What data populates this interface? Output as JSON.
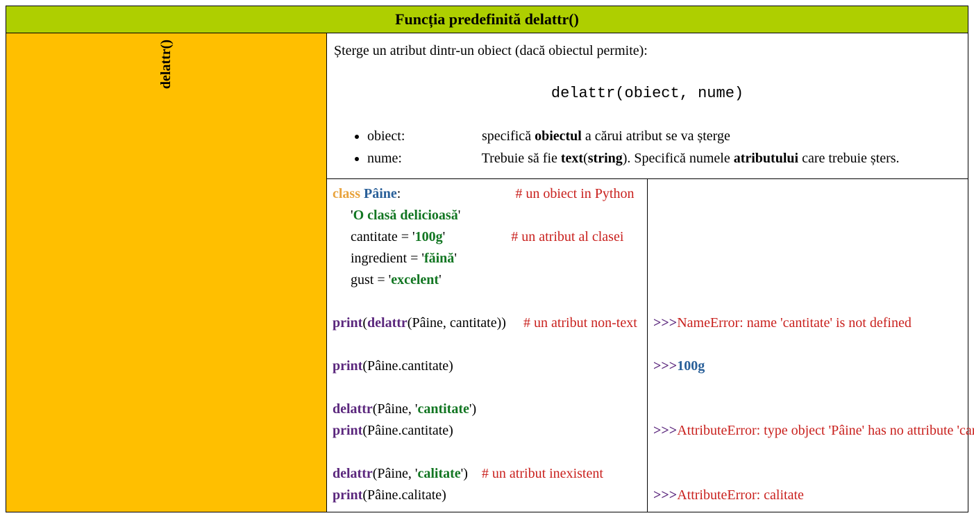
{
  "header": {
    "title": "Funcția predefinită delattr()"
  },
  "sidebar": {
    "label": "delattr()"
  },
  "desc": {
    "intro": "Șterge un atribut dintr-un obiect (dacă obiectul permite):",
    "signature": "delattr(obiect, nume)",
    "params": {
      "p1": {
        "name": "obiect:",
        "pre": "specifică ",
        "bold1": "obiectul",
        "post": " a cărui atribut se va șterge"
      },
      "p2": {
        "name": "nume:",
        "pre": "Trebuie să fie ",
        "bold1": "text",
        "paren_open": "(",
        "bold2": "string",
        "paren_close": "). Specifică numele ",
        "bold3": "atributului",
        "post": " care trebuie șters."
      }
    }
  },
  "code": {
    "l1": {
      "kw": "class ",
      "name": "Pâine",
      "colon": ":",
      "cmt": "# un obiect in Python"
    },
    "l2": {
      "quote_open": "'",
      "str": "O clasă delicioasă",
      "quote_close": "'"
    },
    "l3": {
      "var": "cantitate = '",
      "val": "100g",
      "close": "'",
      "cmt": "# un atribut al clasei"
    },
    "l4": {
      "var": "ingredient = '",
      "val": "făină",
      "close": "'"
    },
    "l5": {
      "var": "gust = '",
      "val": "excelent",
      "close": "'"
    },
    "l6": {
      "fn": "print",
      "open": "(",
      "fn2": "delattr",
      "args": "(Pâine, cantitate))",
      "cmt": "# un atribut non-text"
    },
    "l7": {
      "fn": "print",
      "args": "(Pâine.cantitate)"
    },
    "l8": {
      "fn": "delattr",
      "open": "(Pâine, '",
      "str": "cantitate",
      "close": "')"
    },
    "l9": {
      "fn": "print",
      "args": "(Pâine.cantitate)"
    },
    "l10": {
      "fn": "delattr",
      "open": "(Pâine, '",
      "str": "calitate",
      "close": "')",
      "cmt": "# un atribut inexistent"
    },
    "l11": {
      "fn": "print",
      "args": "(Pâine.calitate)"
    }
  },
  "output": {
    "prompt": ">>>",
    "o1": "NameError: name 'cantitate' is not defined",
    "o2": "100g",
    "o3": "AttributeError: type object 'Pâine' has no attribute 'cantitate'",
    "o4": "AttributeError: calitate"
  }
}
